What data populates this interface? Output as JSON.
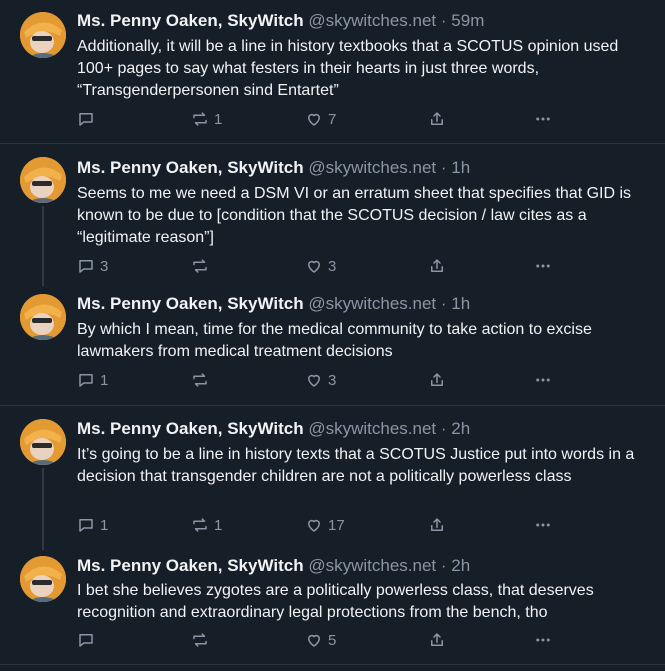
{
  "posts": [
    {
      "name": "Ms. Penny Oaken, SkyWitch",
      "handle": "@skywitches.net",
      "time": "59m",
      "text": "Additionally, it will be a line in history textbooks that a SCOTUS opinion used 100+ pages to say what festers in their hearts in just three words, “Transgenderpersonen sind Entartet”",
      "replies": "",
      "reposts": "1",
      "likes": "7"
    },
    {
      "name": "Ms. Penny Oaken, SkyWitch",
      "handle": "@skywitches.net",
      "time": "1h",
      "text": "Seems to me we need a DSM VI or an erratum sheet that specifies that GID is known to be due to [condition that the SCOTUS decision / law cites as a “legitimate reason”]",
      "replies": "3",
      "reposts": "",
      "likes": "3"
    },
    {
      "name": "Ms. Penny Oaken, SkyWitch",
      "handle": "@skywitches.net",
      "time": "1h",
      "text": "By which I mean, time for the medical community to take action to excise lawmakers from medical treatment decisions",
      "replies": "1",
      "reposts": "",
      "likes": "3"
    },
    {
      "name": "Ms. Penny Oaken, SkyWitch",
      "handle": "@skywitches.net",
      "time": "2h",
      "text": "It’s going to be a line in history texts that a SCOTUS Justice put into words in a decision that transgender children are not a politically powerless class",
      "replies": "1",
      "reposts": "1",
      "likes": "17"
    },
    {
      "name": "Ms. Penny Oaken, SkyWitch",
      "handle": "@skywitches.net",
      "time": "2h",
      "text": "I bet she believes zygotes are a politically powerless class, that deserves recognition and extraordinary legal protections from the bench, tho",
      "replies": "",
      "reposts": "",
      "likes": "5"
    }
  ],
  "separator": "·",
  "icons": {
    "reply": "reply-icon",
    "repost": "repost-icon",
    "like": "heart-icon",
    "share": "share-icon",
    "more": "more-icon"
  },
  "colors": {
    "background": "#161e27",
    "text": "#f1f3f5",
    "muted": "#8996a5",
    "divider": "#2a343f",
    "thread": "#2e3a47"
  }
}
